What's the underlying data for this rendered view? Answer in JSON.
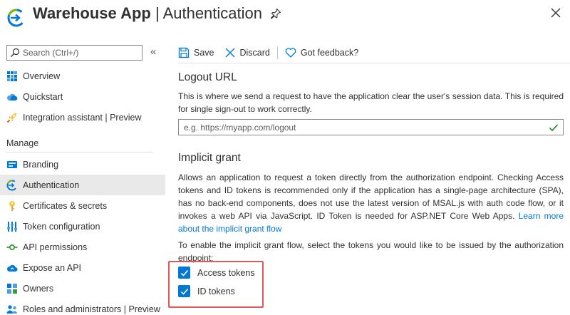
{
  "header": {
    "app_name": "Warehouse App",
    "separator": " | ",
    "page_name": "Authentication"
  },
  "sidebar": {
    "search_placeholder": "Search (Ctrl+/)",
    "collapse_glyph": "«",
    "top_items": [
      {
        "label": "Overview",
        "icon": "grid-icon"
      },
      {
        "label": "Quickstart",
        "icon": "cloud-icon"
      },
      {
        "label": "Integration assistant | Preview",
        "icon": "rocket-icon"
      }
    ],
    "section_label": "Manage",
    "manage_items": [
      {
        "label": "Branding",
        "icon": "branding-icon"
      },
      {
        "label": "Authentication",
        "icon": "authentication-icon",
        "active": true
      },
      {
        "label": "Certificates & secrets",
        "icon": "key-icon"
      },
      {
        "label": "Token configuration",
        "icon": "token-config-icon"
      },
      {
        "label": "API permissions",
        "icon": "api-permissions-icon"
      },
      {
        "label": "Expose an API",
        "icon": "cloud-expose-icon"
      },
      {
        "label": "Owners",
        "icon": "owners-icon"
      },
      {
        "label": "Roles and administrators | Preview",
        "icon": "roles-icon"
      }
    ]
  },
  "toolbar": {
    "save_label": "Save",
    "discard_label": "Discard",
    "feedback_label": "Got feedback?"
  },
  "logout": {
    "heading": "Logout URL",
    "description": "This is where we send a request to have the application clear the user's session data. This is required for single sign-out to work correctly.",
    "input_placeholder": "e.g. https://myapp.com/logout",
    "input_value": ""
  },
  "implicit": {
    "heading": "Implicit grant",
    "description": "Allows an application to request a token directly from the authorization endpoint. Checking Access tokens and ID tokens is recommended only if the application has a single-page architecture (SPA), has no back-end components, does not use the latest version of MSAL.js with auth code flow, or it invokes a web API via JavaScript. ID Token is needed for ASP.NET Core Web Apps.",
    "link_text": "Learn more about the implicit grant flow",
    "instruction": "To enable the implicit grant flow, select the tokens you would like to be issued by the authorization endpoint:",
    "tokens": [
      {
        "label": "Access tokens",
        "checked": true
      },
      {
        "label": "ID tokens",
        "checked": true
      }
    ]
  },
  "colors": {
    "accent": "#0078d4",
    "highlight_border": "#e05a5a",
    "active_nav": "#e9e9e9",
    "valid_check": "#107c10"
  }
}
